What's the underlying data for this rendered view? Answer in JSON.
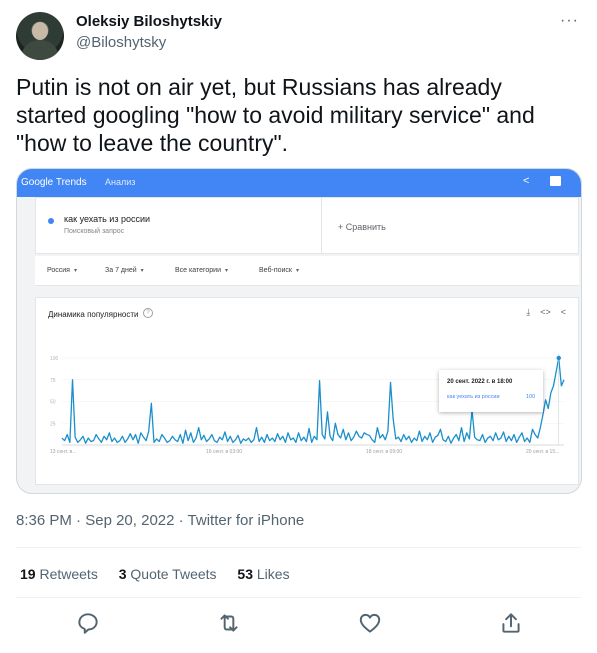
{
  "author": {
    "name": "Oleksiy Biloshytskiy",
    "handle": "@Biloshytsky",
    "more_icon": "more-horizontal-icon"
  },
  "tweet": {
    "text": "Putin is not on air yet, but Russians has already started googling \"how to avoid military service\" and \"how to leave the country\"."
  },
  "screenshot": {
    "header": {
      "logo": "Google Trends",
      "section": "Анализ"
    },
    "search": {
      "term": "как уехать из россии",
      "term_type": "Поисковый запрос",
      "compare": "+ Сравнить"
    },
    "filters": [
      "Россия",
      "За 7 дней",
      "Все категории",
      "Веб-поиск"
    ],
    "chart_title": "Динамика популярности",
    "tooltip": {
      "date": "20 сент. 2022 г. в 18:00",
      "label": "как уехать из россии",
      "value": "100"
    },
    "colors": {
      "accent": "#4285f4",
      "line": "#1a8fcc"
    }
  },
  "chart_data": {
    "type": "line",
    "title": "Динамика популярности",
    "series": [
      {
        "name": "как уехать из россии",
        "values": [
          8,
          5,
          12,
          3,
          75,
          9,
          3,
          6,
          10,
          2,
          8,
          4,
          5,
          12,
          7,
          3,
          10,
          6,
          14,
          4,
          8,
          3,
          5,
          10,
          3,
          7,
          13,
          6,
          12,
          2,
          14,
          9,
          5,
          16,
          48,
          3,
          7,
          4,
          12,
          8,
          3,
          5,
          10,
          6,
          4,
          12,
          2,
          17,
          5,
          14,
          3,
          8,
          20,
          6,
          11,
          4,
          7,
          12,
          5,
          3,
          9,
          6,
          15,
          4,
          10,
          3,
          6,
          11,
          2,
          7,
          5,
          8,
          3,
          6,
          20,
          4,
          9,
          3,
          12,
          5,
          8,
          4,
          13,
          6,
          10,
          3,
          14,
          6,
          8,
          3,
          14,
          5,
          9,
          4,
          19,
          3,
          10,
          6,
          74,
          12,
          7,
          38,
          10,
          5,
          25,
          12,
          8,
          18,
          6,
          14,
          5,
          9,
          16,
          10,
          8,
          14,
          12,
          11,
          6,
          3,
          20,
          8,
          12,
          6,
          16,
          72,
          30,
          7,
          9,
          4,
          12,
          6,
          10,
          3,
          8,
          5,
          16,
          4,
          10,
          6,
          14,
          3,
          9,
          11,
          18,
          6,
          4,
          10,
          2,
          8,
          12,
          5,
          20,
          4,
          14,
          7,
          40,
          9,
          6,
          5,
          12,
          3,
          8,
          10,
          5,
          14,
          6,
          8,
          15,
          4,
          10,
          5,
          12,
          3,
          9,
          14,
          4,
          8,
          3,
          18,
          12,
          8,
          20,
          35,
          52,
          42,
          60,
          68,
          84,
          100,
          68,
          75
        ]
      }
    ],
    "x_tick_labels": [
      "13 сент. в...",
      "16 сент. в 03:00",
      "18 сент. в 09:00",
      "20 сент. в 15..."
    ],
    "y_tick_labels": [
      "100",
      "75",
      "50",
      "25"
    ],
    "ylim": [
      0,
      100
    ],
    "grid": true
  },
  "meta": {
    "time": "8:36 PM",
    "sep": " · ",
    "date": "Sep 20, 2022",
    "source": "Twitter for iPhone"
  },
  "stats": {
    "retweets_count": "19",
    "retweets_label": " Retweets",
    "quotes_count": "3",
    "quotes_label": " Quote Tweets",
    "likes_count": "53",
    "likes_label": " Likes"
  }
}
